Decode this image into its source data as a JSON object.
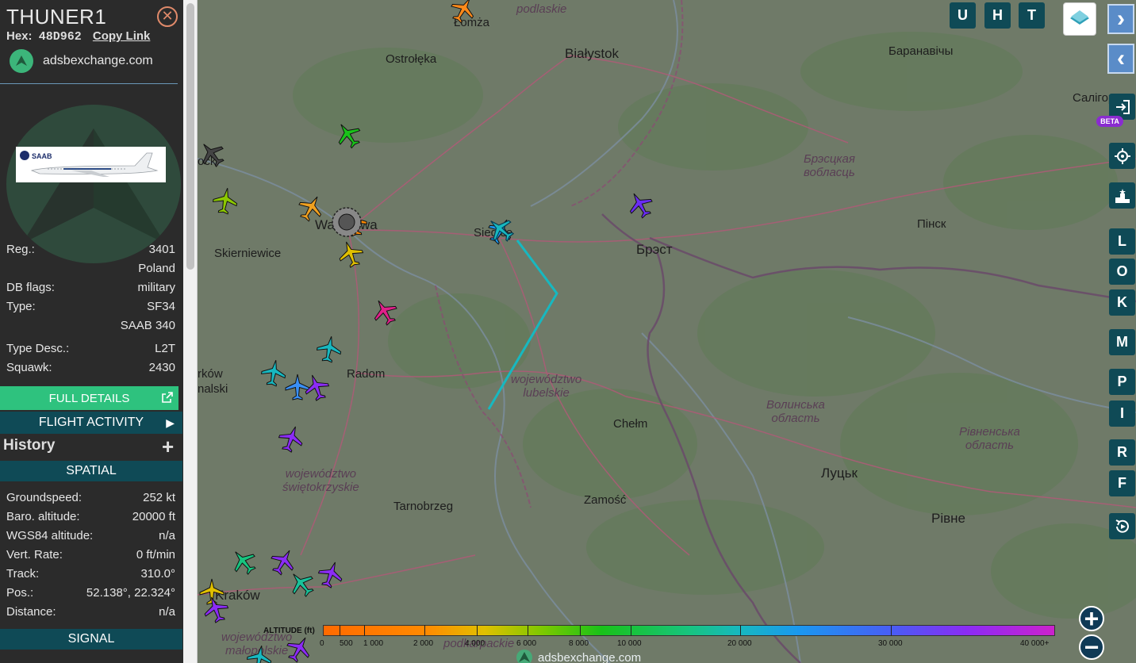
{
  "aircraft": {
    "callsign": "THUNER1",
    "hex_label": "Hex:",
    "hex": "48D962",
    "copy_link": "Copy Link",
    "source": "adsbexchange.com"
  },
  "details": {
    "reg_label": "Reg.:",
    "reg": "3401",
    "country": "Poland",
    "dbflags_label": "DB flags:",
    "dbflags": "military",
    "type_label": "Type:",
    "type": "SF34",
    "model": "SAAB 340",
    "typedesc_label": "Type Desc.:",
    "typedesc": "L2T",
    "squawk_label": "Squawk:",
    "squawk": "2430"
  },
  "buttons": {
    "full_details": "FULL DETAILS",
    "flight_activity": "FLIGHT ACTIVITY",
    "history": "History",
    "spatial": "SPATIAL",
    "signal": "SIGNAL"
  },
  "spatial": {
    "groundspeed_label": "Groundspeed:",
    "groundspeed": "252 kt",
    "baro_label": "Baro. altitude:",
    "baro": "20000 ft",
    "wgs_label": "WGS84 altitude:",
    "wgs": "n/a",
    "vrate_label": "Vert. Rate:",
    "vrate": "0 ft/min",
    "track_label": "Track:",
    "track": "310.0°",
    "pos_label": "Pos.:",
    "pos": "52.138°, 22.324°",
    "distance_label": "Distance:",
    "distance": "n/a"
  },
  "map_labels": {
    "podlaskie": "podlaskie",
    "lomza": "Łomża",
    "ostroleka": "Ostrołęka",
    "bialystok": "Białystok",
    "baranavichy": "Баранавічы",
    "salihorsk": "Салігорск",
    "brest_region_1": "Брэсцкая",
    "brest_region_2": "вобласць",
    "pinsk": "Пінск",
    "brest": "Брэст",
    "warszawa": "Warszawa",
    "skierniewice": "Skierniewice",
    "siedlce": "Siedlce",
    "radom": "Radom",
    "lubelskie_1": "województwo",
    "lubelskie_2": "lubelskie",
    "chelm": "Chełm",
    "volyn_1": "Волинська",
    "volyn_2": "область",
    "rivne_region_1": "Рівненська",
    "rivne_region_2": "область",
    "swietokrzyskie_1": "województwo",
    "swietokrzyskie_2": "świętokrzyskie",
    "tarnobrzeg": "Tarnobrzeg",
    "zamosc": "Zamość",
    "lutsk": "Луцьк",
    "rivne": "Рівне",
    "krakow": "Kraków",
    "ock": "ock",
    "kow": "rków",
    "malski": "nalski",
    "wojewodztwo_bottom": "województwo",
    "malopolskie": "małopolskie",
    "podkarpackie": "podkarpackie"
  },
  "controls": {
    "u": "U",
    "h": "H",
    "t": "T",
    "l": "L",
    "o": "O",
    "k": "K",
    "m": "M",
    "p": "P",
    "i": "I",
    "r": "R",
    "f": "F",
    "beta": "BETA"
  },
  "altitude_legend": {
    "title": "ALTITUDE (ft)",
    "ticks": [
      "0",
      "500",
      "1 000",
      "2 000",
      "4 000",
      "6 000",
      "8 000",
      "10 000",
      "20 000",
      "30 000",
      "40 000+"
    ]
  },
  "footer": {
    "brand": "adsbexchange.com"
  },
  "colors": {
    "panel": "#2b2b2b",
    "teal": "#0f4a56",
    "green": "#2ec27e",
    "track": "#17b8c0"
  }
}
